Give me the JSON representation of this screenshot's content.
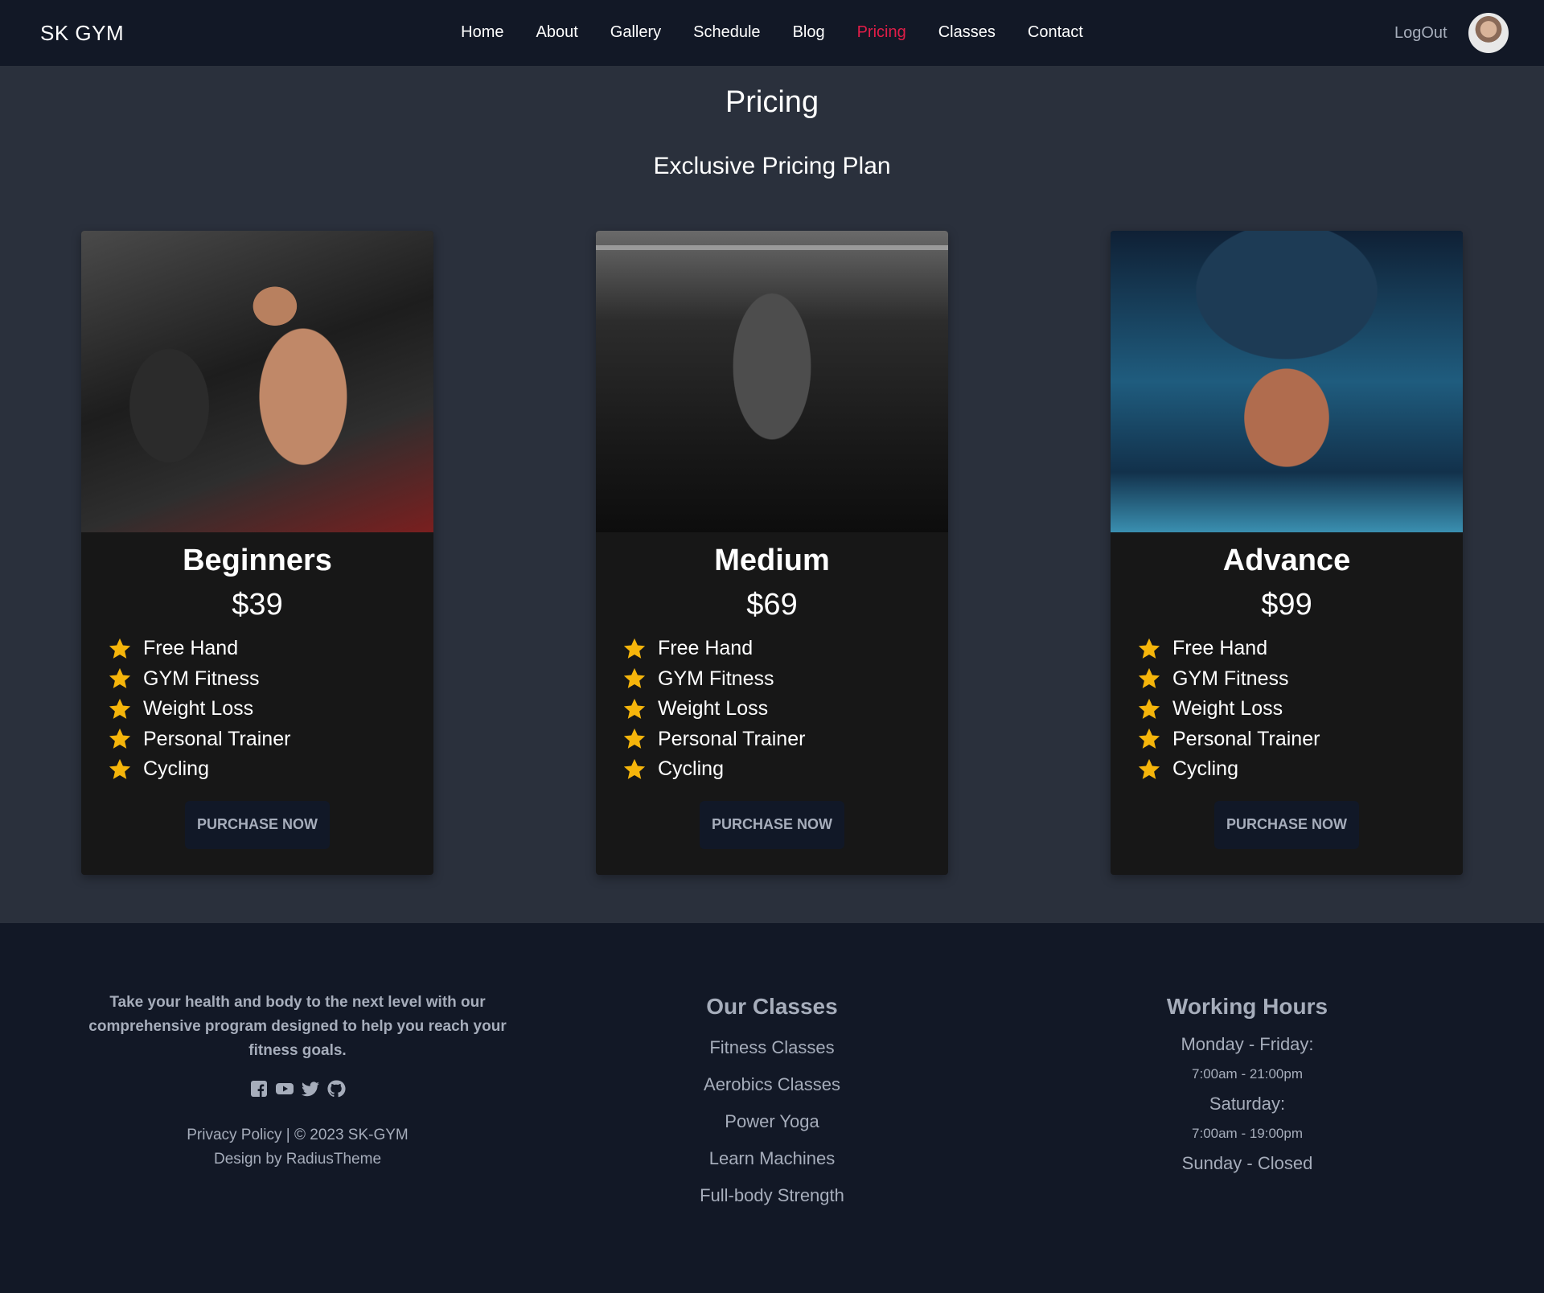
{
  "nav": {
    "brand": "SK GYM",
    "links": [
      "Home",
      "About",
      "Gallery",
      "Schedule",
      "Blog",
      "Pricing",
      "Classes",
      "Contact"
    ],
    "active": "Pricing",
    "active_color": "#e11d48",
    "logout": "LogOut"
  },
  "header": {
    "title": "Pricing",
    "subtitle": "Exclusive Pricing Plan"
  },
  "plans": [
    {
      "name": "Beginners",
      "price": "$39",
      "features": [
        "Free Hand",
        "GYM Fitness",
        "Weight Loss",
        "Personal Trainer",
        "Cycling"
      ],
      "button": "PURCHASE NOW"
    },
    {
      "name": "Medium",
      "price": "$69",
      "features": [
        "Free Hand",
        "GYM Fitness",
        "Weight Loss",
        "Personal Trainer",
        "Cycling"
      ],
      "button": "PURCHASE NOW"
    },
    {
      "name": "Advance",
      "price": "$99",
      "features": [
        "Free Hand",
        "GYM Fitness",
        "Weight Loss",
        "Personal Trainer",
        "Cycling"
      ],
      "button": "PURCHASE NOW"
    }
  ],
  "footer": {
    "about": "Take your health and body to the next level with our comprehensive program designed to help you reach your fitness goals.",
    "social_icons": [
      "facebook-icon",
      "youtube-icon",
      "twitter-icon",
      "github-icon"
    ],
    "legal": "Privacy Policy | © 2023 SK-GYM",
    "credit": "Design by RadiusTheme",
    "classes_title": "Our Classes",
    "classes": [
      "Fitness Classes",
      "Aerobics Classes",
      "Power Yoga",
      "Learn Machines",
      "Full-body Strength"
    ],
    "hours_title": "Working Hours",
    "hours": {
      "weekday_label": "Monday - Friday:",
      "weekday_time": "7:00am - 21:00pm",
      "saturday_label": "Saturday:",
      "saturday_time": "7:00am - 19:00pm",
      "sunday": "Sunday - Closed"
    }
  },
  "colors": {
    "nav_bg": "#121826",
    "page_bg": "#2a303c",
    "card_bg": "#171717",
    "star": "#f5b50b",
    "muted_text": "#a6adbb"
  }
}
